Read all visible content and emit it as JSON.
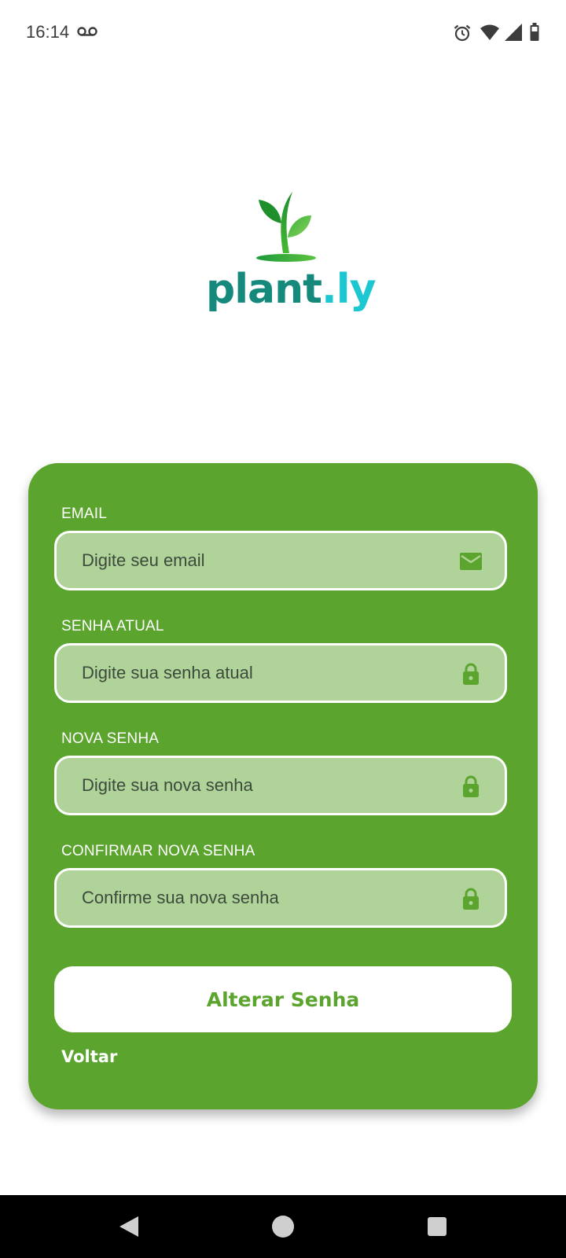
{
  "status_bar": {
    "time": "16:14",
    "icons": [
      "voicemail-icon",
      "alarm-icon",
      "wifi-icon",
      "signal-icon",
      "battery-icon"
    ]
  },
  "logo": {
    "text_dark": "plant",
    "text_light": ".ly",
    "colors": {
      "sprout": "#2aa52a",
      "text_dark": "#15897c",
      "text_light": "#1cc7d2"
    }
  },
  "form": {
    "background": "#5ba52e",
    "fields": [
      {
        "label": "EMAIL",
        "placeholder": "Digite seu email",
        "value": "",
        "icon": "mail-icon"
      },
      {
        "label": "SENHA ATUAL",
        "placeholder": "Digite sua senha atual",
        "value": "",
        "icon": "lock-icon"
      },
      {
        "label": "NOVA SENHA",
        "placeholder": "Digite sua nova senha",
        "value": "",
        "icon": "lock-icon"
      },
      {
        "label": "CONFIRMAR NOVA SENHA",
        "placeholder": "Confirme sua nova senha",
        "value": "",
        "icon": "lock-icon"
      }
    ],
    "submit_label": "Alterar Senha",
    "back_label": "Voltar"
  },
  "nav_bar": {
    "icons": [
      "back-icon",
      "home-icon",
      "recents-icon"
    ]
  }
}
